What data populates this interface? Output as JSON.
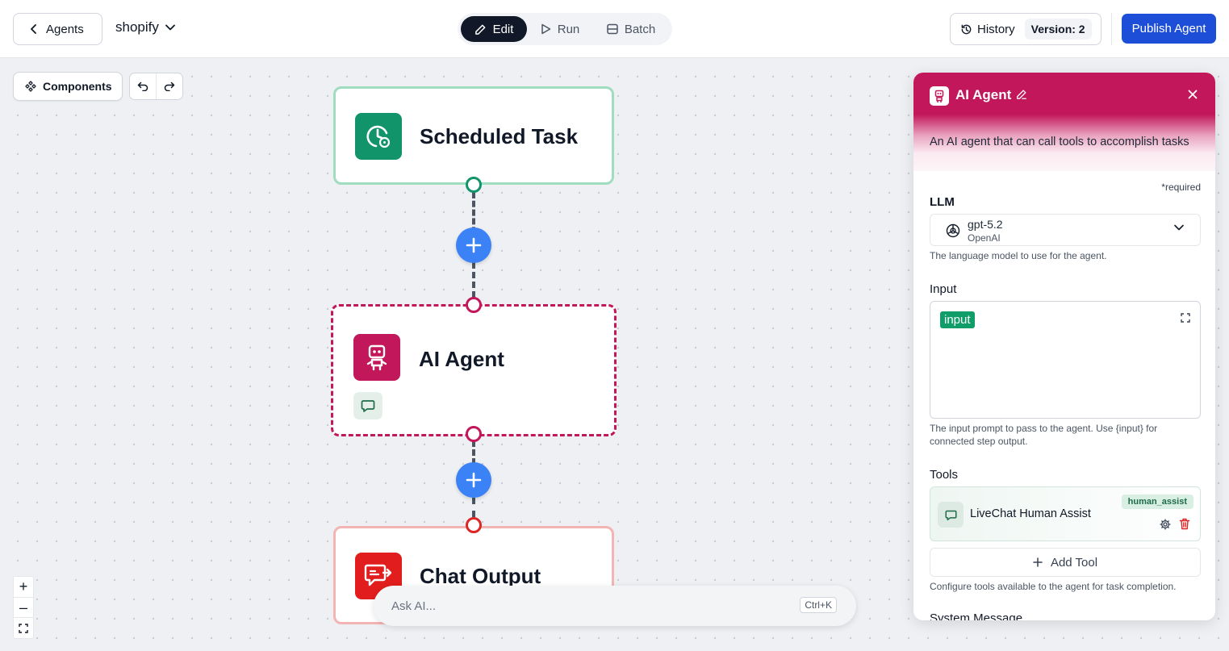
{
  "topbar": {
    "back_label": "Agents",
    "project_name": "shopify",
    "modes": [
      {
        "label": "Edit",
        "active": true
      },
      {
        "label": "Run",
        "active": false
      },
      {
        "label": "Batch",
        "active": false
      }
    ],
    "history_label": "History",
    "version_label": "Version: 2",
    "publish_label": "Publish Agent"
  },
  "canvas": {
    "components_label": "Components",
    "nodes": {
      "scheduled": {
        "title": "Scheduled Task",
        "icon": "clock-icon",
        "color": "#12946b"
      },
      "agent": {
        "title": "AI Agent",
        "icon": "robot-icon",
        "color": "#c2185b"
      },
      "output": {
        "title": "Chat Output",
        "icon": "chat-send-icon",
        "color": "#e11d1d"
      }
    },
    "ask_ai": {
      "placeholder": "Ask AI...",
      "shortcut": "Ctrl+K"
    },
    "zoom": {
      "in": "+",
      "out": "–"
    }
  },
  "panel": {
    "title": "AI Agent",
    "description": "An AI agent that can call tools to accomplish tasks",
    "required_note": "*required",
    "llm": {
      "label": "LLM",
      "model": "gpt-5.2",
      "provider": "OpenAI",
      "help": "The language model to use for the agent."
    },
    "input": {
      "label": "Input",
      "token": "input",
      "help": "The input prompt to pass to the agent. Use {input} for connected step output."
    },
    "tools": {
      "label": "Tools",
      "items": [
        {
          "name": "LiveChat Human Assist",
          "badge": "human_assist"
        }
      ],
      "add_label": "Add Tool",
      "help": "Configure tools available to the agent for task completion."
    },
    "system_message_label": "System Message"
  }
}
